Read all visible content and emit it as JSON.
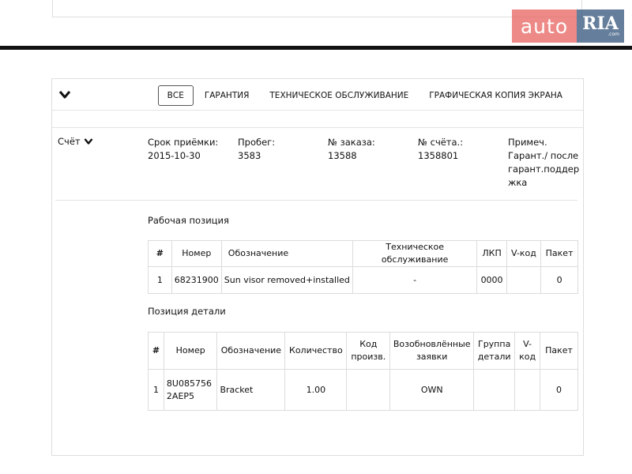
{
  "logo": {
    "left_text": "auto",
    "right_text": "RIA",
    "right_sub": ".com"
  },
  "tabs": [
    {
      "label": "ВСЕ",
      "active": true
    },
    {
      "label": "ГАРАНТИЯ",
      "active": false
    },
    {
      "label": "ТЕХНИЧЕСКОЕ ОБСЛУЖИВАНИЕ",
      "active": false
    },
    {
      "label": "ГРАФИЧЕСКАЯ КОПИЯ ЭКРАНА",
      "active": false
    }
  ],
  "invoice": {
    "toggle_label": "Счёт",
    "fields": {
      "intake_date": {
        "label": "Срок приёмки:",
        "value": "2015-10-30"
      },
      "mileage": {
        "label": "Пробег:",
        "value": "3583"
      },
      "order_no": {
        "label": "№ заказа:",
        "value": "13588"
      },
      "invoice_no": {
        "label": "№ счёта.:",
        "value": "1358801"
      },
      "note": {
        "label": "Примеч.",
        "value": "Гарант./ послегарант.поддержка"
      }
    }
  },
  "work_section": {
    "title": "Рабочая позиция",
    "headers": [
      "#",
      "Номер",
      "Обозначение",
      "Техническое обслуживание",
      "ЛКП",
      "V-код",
      "Пакет"
    ],
    "rows": [
      [
        "1",
        "68231900",
        "Sun visor removed+installed",
        "-",
        "0000",
        "",
        "0"
      ]
    ]
  },
  "parts_section": {
    "title": "Позиция детали",
    "headers": [
      "#",
      "Номер",
      "Обозначение",
      "Количество",
      "Код произв.",
      "Возобновлённые заявки",
      "Группа детали",
      "V-код",
      "Пакет"
    ],
    "rows": [
      [
        "1",
        "8U0857562AEP5",
        "Bracket",
        "1.00",
        "",
        "OWN",
        "",
        "",
        "0"
      ]
    ]
  }
}
